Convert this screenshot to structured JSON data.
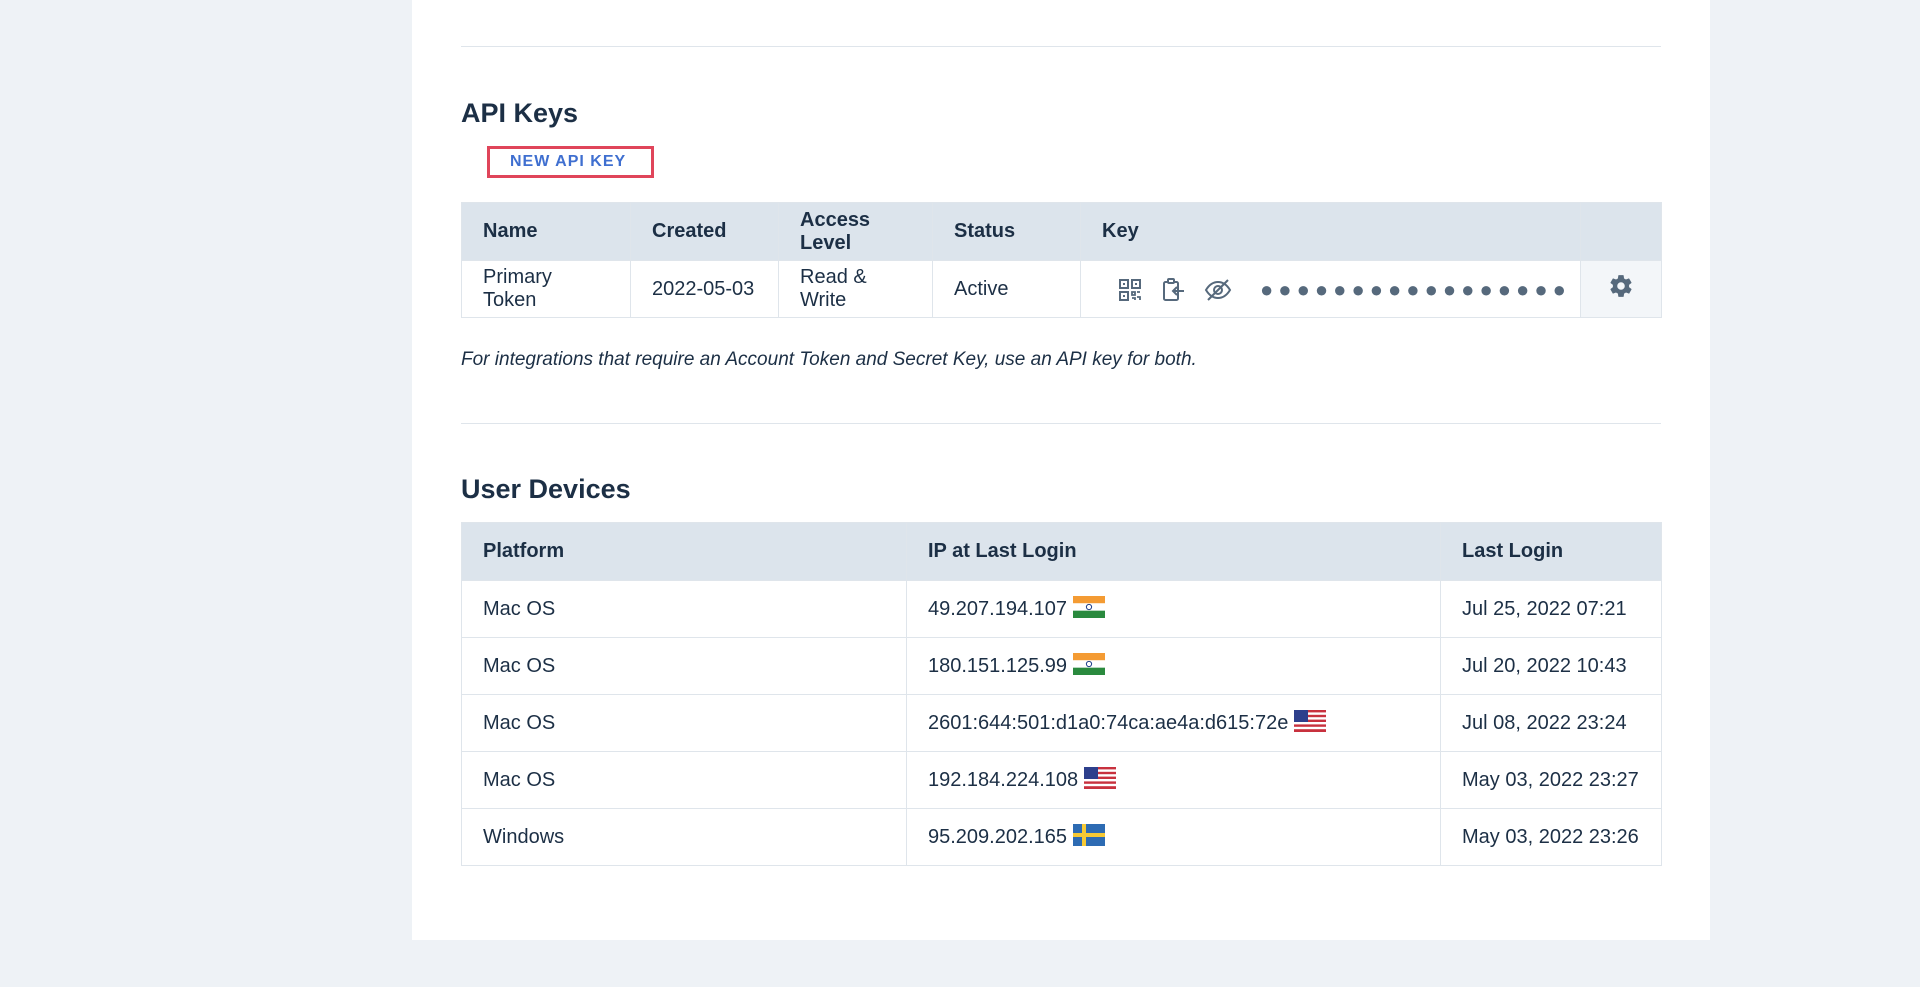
{
  "api_keys": {
    "title": "API Keys",
    "new_button_label": "NEW API KEY",
    "columns": [
      "Name",
      "Created",
      "Access Level",
      "Status",
      "Key",
      ""
    ],
    "rows": [
      {
        "name": "Primary Token",
        "created": "2022-05-03",
        "access_level": "Read & Write",
        "status": "Active",
        "key_masked": "●●●●●●●●●●●●●●●●●",
        "icons": [
          "qr-code-icon",
          "copy-to-clipboard-icon",
          "eye-slash-icon",
          "gear-icon"
        ]
      }
    ],
    "note": "For integrations that require an Account Token and Secret Key, use an API key for both."
  },
  "user_devices": {
    "title": "User Devices",
    "columns": [
      "Platform",
      "IP at Last Login",
      "Last Login"
    ],
    "rows": [
      {
        "platform": "Mac OS",
        "ip": "49.207.194.107",
        "flag": "india",
        "last_login": "Jul 25, 2022 07:21"
      },
      {
        "platform": "Mac OS",
        "ip": "180.151.125.99",
        "flag": "india",
        "last_login": "Jul 20, 2022 10:43"
      },
      {
        "platform": "Mac OS",
        "ip": "2601:644:501:d1a0:74ca:ae4a:d615:72e",
        "flag": "usa",
        "last_login": "Jul 08, 2022 23:24"
      },
      {
        "platform": "Mac OS",
        "ip": "192.184.224.108",
        "flag": "usa",
        "last_login": "May 03, 2022 23:27"
      },
      {
        "platform": "Windows",
        "ip": "95.209.202.165",
        "flag": "sweden",
        "last_login": "May 03, 2022 23:26"
      }
    ]
  },
  "colors": {
    "page_bg": "#eef2f6",
    "card_bg": "#ffffff",
    "header_bg": "#dce4ec",
    "text": "#1c2f45",
    "link": "#3f6fd0",
    "highlight_border": "#e0455a"
  }
}
